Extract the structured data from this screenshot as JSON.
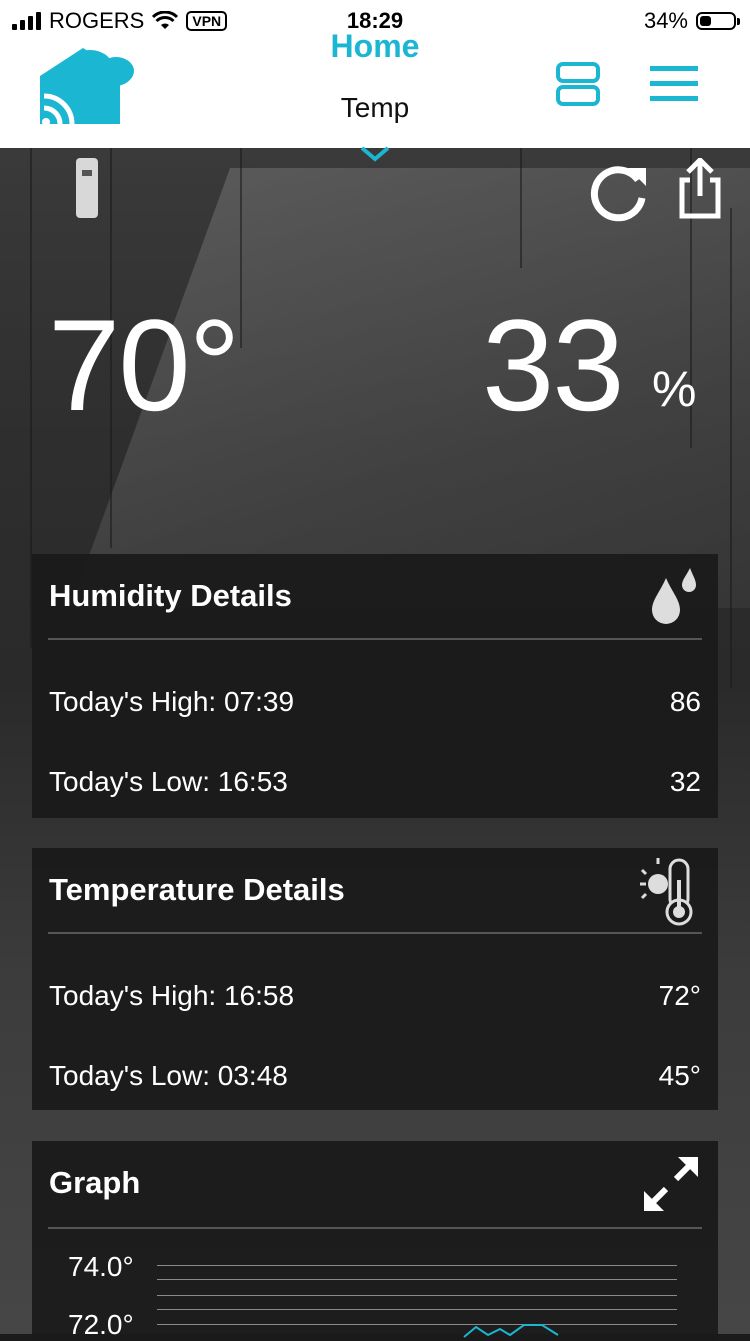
{
  "status_bar": {
    "carrier": "ROGERS",
    "vpn": "VPN",
    "time": "18:29",
    "battery": "34%",
    "battery_level": 0.34
  },
  "header": {
    "title": "Home",
    "subtitle": "Temp",
    "accent_color": "#1ab6d2"
  },
  "current": {
    "temperature": "70°",
    "humidity": "33",
    "humidity_unit": "%"
  },
  "humidity_details": {
    "title": "Humidity Details",
    "icon": "water-drops-icon",
    "rows": [
      {
        "label": "Today's High: 07:39",
        "value": "86"
      },
      {
        "label": "Today's Low: 16:53",
        "value": "32"
      }
    ]
  },
  "temperature_details": {
    "title": "Temperature Details",
    "icon": "sun-thermometer-icon",
    "rows": [
      {
        "label": "Today's High: 16:58",
        "value": "72°"
      },
      {
        "label": "Today's Low: 03:48",
        "value": "45°"
      }
    ]
  },
  "graph": {
    "title": "Graph",
    "icon": "expand-icon",
    "y_labels": [
      "74.0°",
      "72.0°"
    ]
  }
}
